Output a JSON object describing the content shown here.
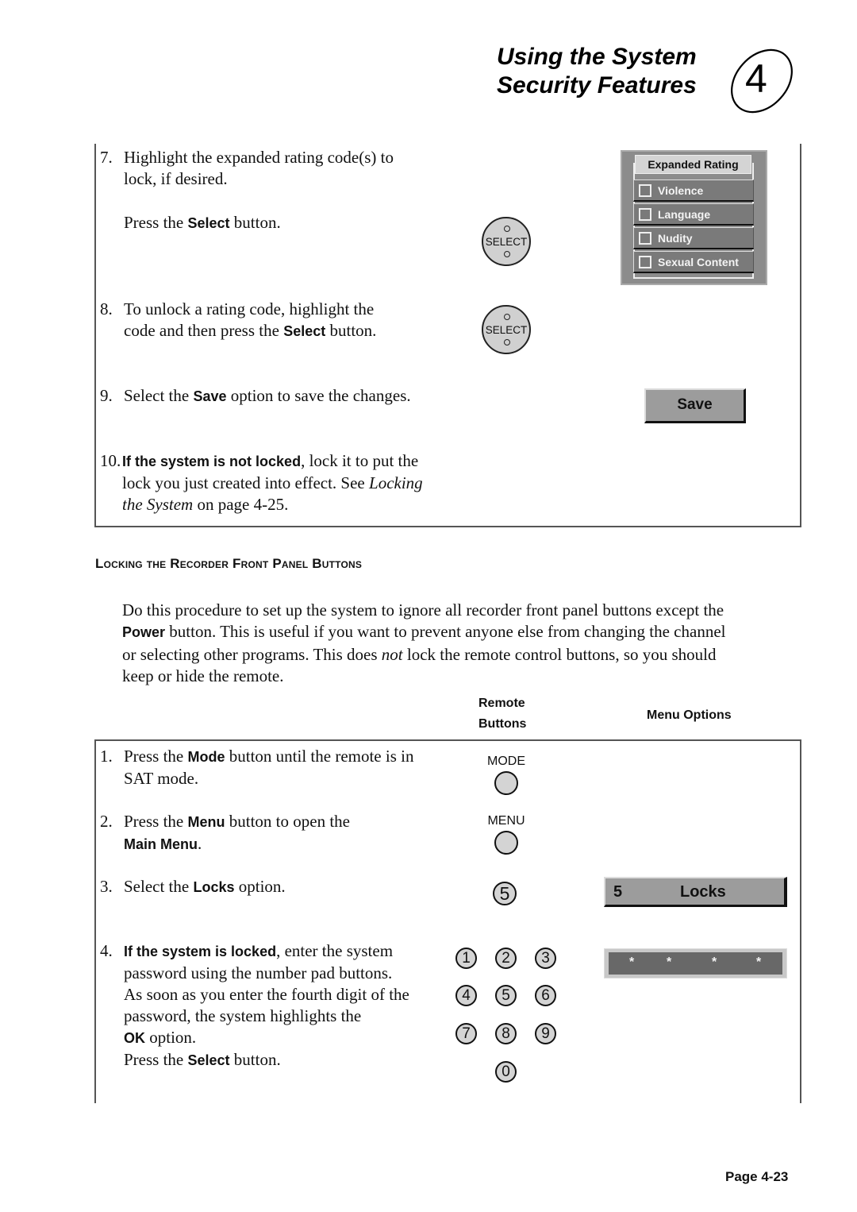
{
  "header": {
    "title_line1": "Using the System",
    "title_line2": "Security Features",
    "chapter_number": "4"
  },
  "section1": {
    "steps": [
      {
        "num": "7.",
        "line1": "Highlight the expanded rating code(s) to",
        "line2": "lock, if desired.",
        "press_pre": "Press the ",
        "press_bold": "Select",
        "press_post": " button."
      },
      {
        "num": "8.",
        "line1": "To unlock a rating code, highlight the",
        "line2_pre": "code and then press the ",
        "line2_bold": "Select",
        "line2_post": " button."
      },
      {
        "num": "9.",
        "pre": "Select the ",
        "bold": "Save",
        "post": " option to save the changes."
      },
      {
        "num": "10.",
        "bold": "If the system is not locked",
        "post1": ", lock it to put the",
        "line2_pre": "lock you just created into effect.  See ",
        "line2_italic": "Locking",
        "line3_italic": "the System",
        "line3_post": " on page 4-25."
      }
    ],
    "select_button_label": "SELECT",
    "expanded_rating": {
      "title": "Expanded Rating",
      "items": [
        {
          "label": "Violence",
          "checked": false
        },
        {
          "label": "Language",
          "checked": false
        },
        {
          "label": "Nudity",
          "checked": false
        },
        {
          "label": "Sexual Content",
          "checked": false
        }
      ]
    },
    "save_button_label": "Save"
  },
  "section2": {
    "heading": "Locking the Recorder Front Panel Buttons",
    "intro": {
      "p1": "Do this procedure to set up the system to ignore all recorder front panel buttons except the",
      "p2_bold": "Power",
      "p2": " button.  This is useful if you want to prevent anyone else from changing the channel",
      "p3_pre": "or selecting other programs.  This does ",
      "p3_italic": "not",
      "p3_post": " lock the remote control buttons, so you should",
      "p4": "keep or hide the remote."
    },
    "columns": {
      "remote_line1": "Remote",
      "remote_line2": "Buttons",
      "menu_options": "Menu Options"
    },
    "steps": [
      {
        "num": "1.",
        "pre": "Press the ",
        "bold": "Mode",
        "post": " button until the remote is in",
        "line2": "SAT mode."
      },
      {
        "num": "2.",
        "pre": "Press the ",
        "bold": "Menu",
        "post": " button to open the",
        "line2_bold": "Main Menu",
        "line2_post": "."
      },
      {
        "num": "3.",
        "pre": "Select the ",
        "bold": "Locks",
        "post": " option."
      },
      {
        "num": "4.",
        "bold": "If the system is locked",
        "post": ", enter the system",
        "line2": "password using the number pad buttons.",
        "line3": "As soon as you enter the fourth digit of the",
        "line4": "password, the system highlights the",
        "line5_bold": "OK",
        "line5_post": " option.",
        "line6_pre": "Press the ",
        "line6_bold": "Select",
        "line6_post": " button."
      }
    ],
    "remote_buttons": {
      "mode_label": "MODE",
      "menu_label": "MENU",
      "locks_key": "5",
      "number_pad": [
        "1",
        "2",
        "3",
        "4",
        "5",
        "6",
        "7",
        "8",
        "9",
        "0"
      ]
    },
    "locks_option": {
      "number": "5",
      "label": "Locks"
    },
    "password_field": {
      "masked": [
        "*",
        "*",
        "*",
        "*"
      ]
    }
  },
  "footer": {
    "page": "Page 4-23"
  }
}
